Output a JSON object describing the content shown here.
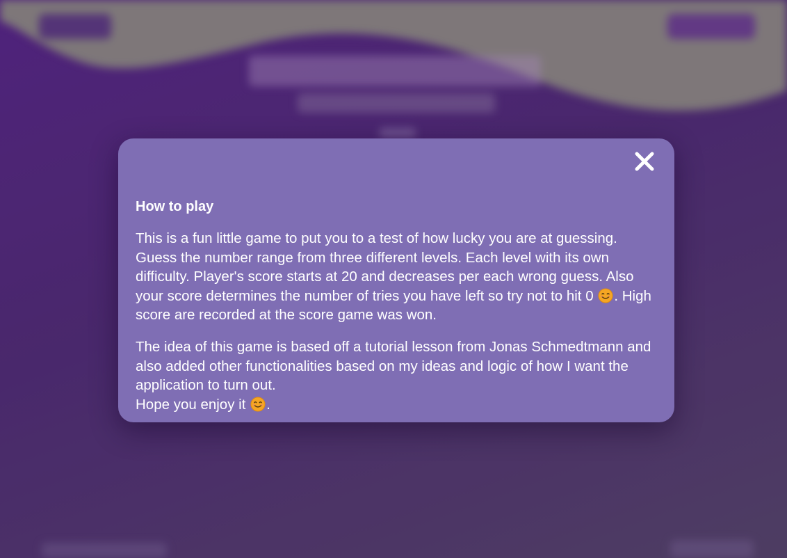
{
  "background": {
    "blurred": true
  },
  "modal": {
    "heading": "How to play",
    "close_icon": "close-icon",
    "paragraph1_text": "This is a fun little game to put you to a test of how lucky you are at guessing. Guess the number range from three different levels. Each level with its own difficulty. Player's score starts at 20 and decreases per each wrong guess. Also your score determines the number of tries you have left so try not to hit 0",
    "paragraph1_emoji": "smiling-face-emoji",
    "paragraph1_tail": ". High score are recorded at the score game was won.",
    "paragraph2_text": "The idea of this game is based off a tutorial lesson from Jonas Schmedtmann and also added other functionalities based on my ideas and logic of how I want the application to turn out.",
    "paragraph2_line2": "Hope you enjoy it",
    "paragraph2_emoji": "smiling-face-emoji",
    "paragraph2_tail": "."
  },
  "colors": {
    "modal_background": "#7f6eb4",
    "page_background_top": "#552585",
    "page_background_bottom": "#534468",
    "text": "#ffffff",
    "emoji_face": "#f5a623"
  }
}
